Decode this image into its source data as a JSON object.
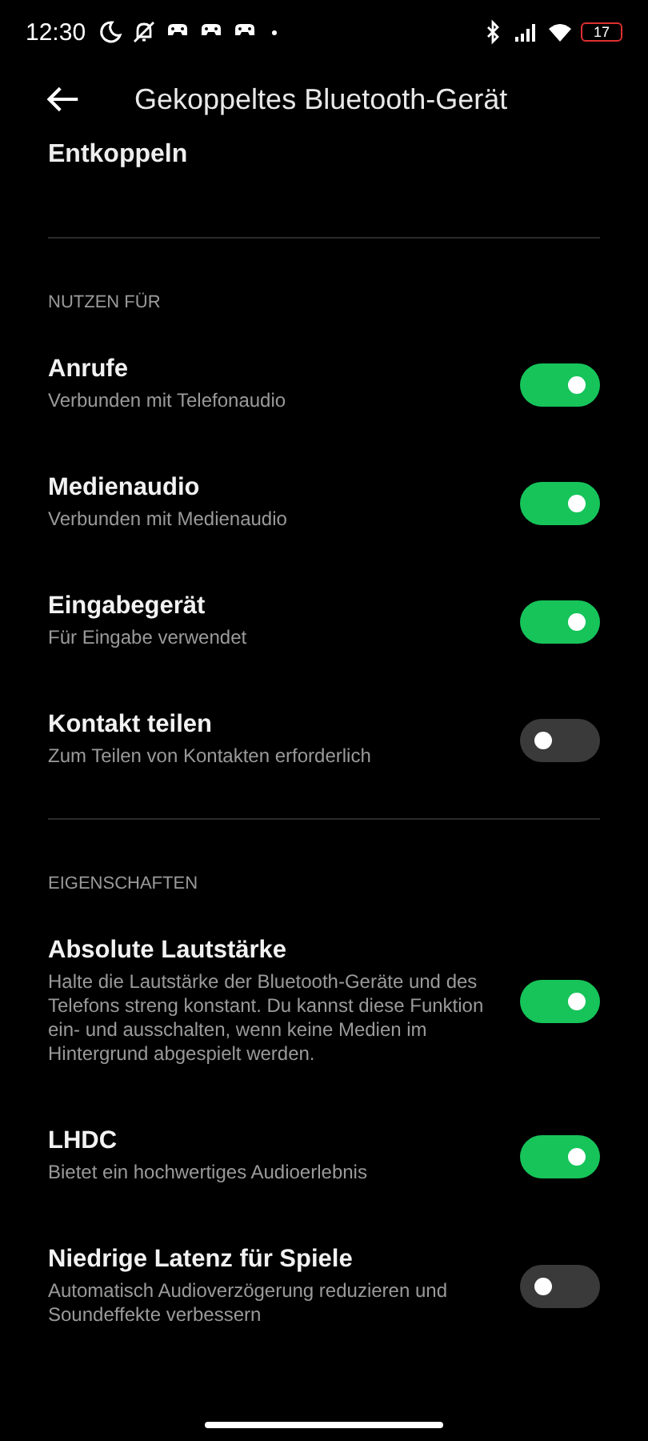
{
  "status_bar": {
    "time": "12:30",
    "battery": "17"
  },
  "header": {
    "title": "Gekoppeltes Bluetooth-Gerät"
  },
  "unpair": {
    "label": "Entkoppeln"
  },
  "sections": [
    {
      "title": "NUTZEN FÜR",
      "items": [
        {
          "title": "Anrufe",
          "subtitle": "Verbunden mit Telefonaudio",
          "on": true
        },
        {
          "title": "Medienaudio",
          "subtitle": "Verbunden mit Medienaudio",
          "on": true
        },
        {
          "title": "Eingabegerät",
          "subtitle": "Für Eingabe verwendet",
          "on": true
        },
        {
          "title": "Kontakt teilen",
          "subtitle": "Zum Teilen von Kontakten erforderlich",
          "on": false
        }
      ]
    },
    {
      "title": "EIGENSCHAFTEN",
      "items": [
        {
          "title": "Absolute Lautstärke",
          "subtitle": "Halte die Lautstärke der Bluetooth-Geräte und des Telefons streng konstant. Du kannst diese Funktion ein- und ausschalten, wenn keine Medien im Hintergrund abgespielt werden.",
          "on": true
        },
        {
          "title": "LHDC",
          "subtitle": "Bietet ein hochwertiges Audioerlebnis",
          "on": true
        },
        {
          "title": "Niedrige Latenz für Spiele",
          "subtitle": "Automatisch Audioverzögerung reduzieren und Soundeffekte verbessern",
          "on": false
        }
      ]
    }
  ]
}
